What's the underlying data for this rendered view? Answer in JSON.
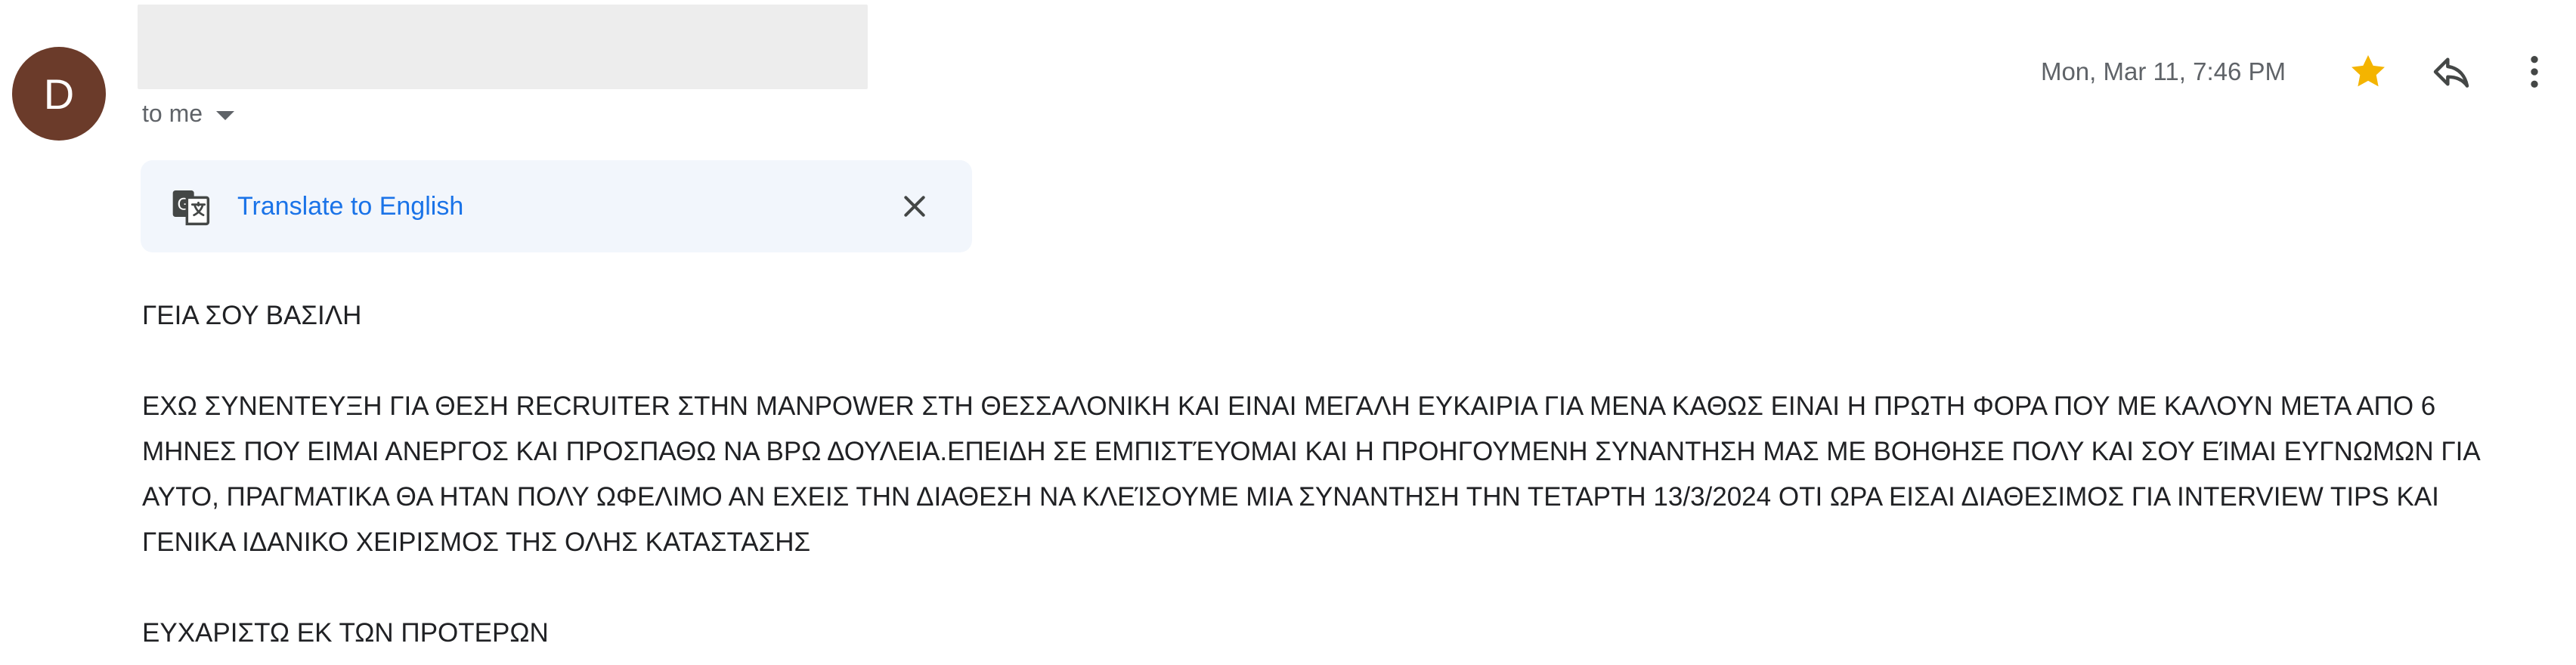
{
  "sender": {
    "avatar_letter": "D",
    "avatar_color": "#6b3b2a"
  },
  "recipient": {
    "label": "to me"
  },
  "header": {
    "timestamp": "Mon, Mar 11, 7:46 PM",
    "star_color": "#f4b400",
    "icons": [
      "star-icon",
      "reply-icon",
      "more-vert-icon"
    ]
  },
  "translate": {
    "link_label": "Translate to English",
    "link_color": "#1a73e8",
    "icons": [
      "translate-icon",
      "close-icon"
    ]
  },
  "message": {
    "greeting": "ΓΕΙΑ ΣΟΥ ΒΑΣΙΛΗ",
    "paragraph": "ΕΧΩ ΣΥΝΕΝΤΕΥΞΗ ΓΙΑ ΘΕΣΗ RECRUITER ΣΤΗΝ  MANPOWER ΣΤΗ ΘΕΣΣΑΛΟΝΙΚΗ ΚΑΙ ΕΙΝΑΙ ΜΕΓΑΛΗ ΕΥΚΑΙΡΙΑ ΓΙΑ ΜΕΝΑ ΚΑΘΩΣ ΕΙΝΑΙ Η ΠΡΩΤΗ ΦΟΡΑ ΠΟΥ ΜΕ ΚΑΛΟΥΝ ΜΕΤΑ ΑΠΟ 6 ΜΗΝΕΣ ΠΟΥ ΕΙΜΑΙ ΑΝΕΡΓΟΣ ΚΑΙ ΠΡΟΣΠΑΘΩ ΝΑ ΒΡΩ ΔΟΥΛΕΙΑ.ΕΠΕΙΔΗ ΣΕ ΕΜΠΙΣΤΈΥΟΜΑΙ ΚΑΙ Η ΠΡΟΗΓΟΥΜΕΝΗ ΣΥΝΑΝΤΗΣΗ ΜΑΣ  ΜΕ ΒΟΗΘΗΣΕ ΠΟΛΥ ΚΑΙ ΣΟΥ ΕΊΜΑΙ ΕΥΓΝΩΜΩΝ ΓΙΑ ΑΥΤΟ, ΠΡΑΓΜΑΤΙΚΑ ΘΑ ΗΤΑΝ ΠΟΛΥ ΩΦΕΛΙΜΟ ΑΝ ΕΧΕΙΣ ΤΗΝ ΔΙΑΘΕΣΗ ΝΑ ΚΛΕΊΣΟΥΜΕ ΜΙΑ ΣΥΝΑΝΤΗΣΗ ΤΗΝ ΤΕΤΑΡΤΗ 13/3/2024  ΟΤΙ ΩΡΑ ΕΙΣΑΙ ΔΙΑΘΕΣΙΜΟΣ ΓΙΑ  INTERVIEW TIPS ΚΑΙ ΓΕΝΙΚΑ ΙΔΑΝΙΚΟ ΧΕΙΡΙΣΜΟΣ ΤΗΣ ΟΛΗΣ ΚΑΤΑΣΤΑΣΗΣ",
    "closing": "ΕΥΧΑΡΙΣΤΩ ΕΚ ΤΩΝ ΠΡΟΤΕΡΩΝ"
  }
}
